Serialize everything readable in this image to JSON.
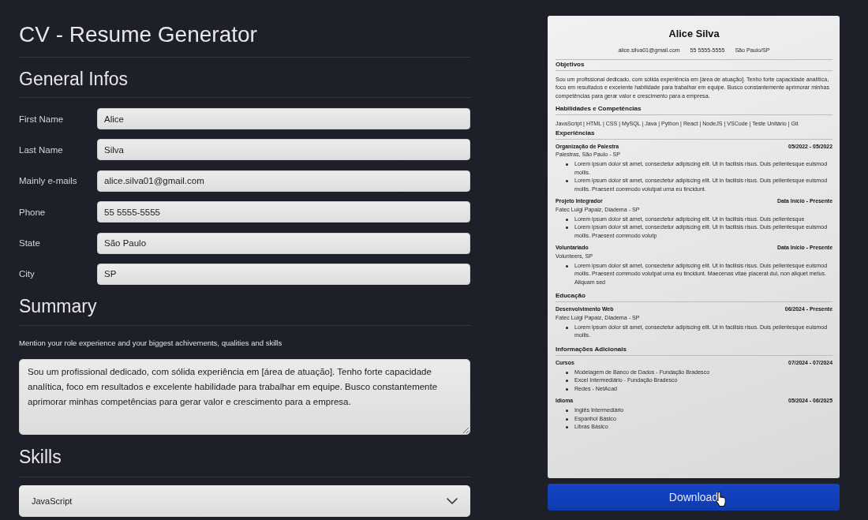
{
  "app": {
    "title": "CV - Resume Generator"
  },
  "general_infos": {
    "heading": "General Infos",
    "fields": [
      {
        "label": "First Name",
        "value": "Alice"
      },
      {
        "label": "Last Name",
        "value": "Silva"
      },
      {
        "label": "Mainly e-mails",
        "value": "alice.silva01@gmail.com"
      },
      {
        "label": "Phone",
        "value": "55 5555-5555"
      },
      {
        "label": "State",
        "value": "São Paulo"
      },
      {
        "label": "City",
        "value": "SP"
      }
    ]
  },
  "summary": {
    "heading": "Summary",
    "hint": "Mention your role experience and your biggest achivements, qualities and skills",
    "value": "Sou um profissional dedicado, com sólida experiência em [área de atuação]. Tenho forte capacidade analítica, foco em resultados e excelente habilidade para trabalhar em equipe. Busco constantemente aprimorar minhas competências para gerar valor e crescimento para a empresa."
  },
  "skills": {
    "heading": "Skills",
    "select": {
      "value": "JavaScript"
    }
  },
  "resume": {
    "name": "Alice Silva",
    "contacts": [
      "alice.silva01@gmail.com",
      "55 5555-5555",
      "São Paulo/SP"
    ],
    "sections": [
      {
        "kind": "paragraph",
        "heading": "Objetivos",
        "text": "Sou um profissional dedicado, com sólida experiência em [área de atuação]. Tenho forte capacidade analítica, foco em resultados e excelente habilidade para trabalhar em equipe. Busco constantemente aprimorar minhas competências para gerar valor e crescimento para a empresa."
      },
      {
        "kind": "line",
        "heading": "Habilidades e Competências",
        "text": "JavaScript | HTML | CSS | MySQL | Java | Python | React | NodeJS | VSCode | Teste Unitário | Git"
      },
      {
        "kind": "entries",
        "heading": "Experiências",
        "entries": [
          {
            "title": "Organização de Palestra",
            "dates": "05/2022 - 05/2022",
            "place": "Palestras, São Paulo - SP",
            "bullets": [
              "Lorem ipsum dolor sit amet, consectetur adipiscing elit. Ut in facilisis risus. Duis pellentesque euismod mollis.",
              "Lorem ipsum dolor sit amet, consectetur adipiscing elit. Ut in facilisis risus. Duis pellentesque euismod mollis. Praesent commodo volutpat urna eu tincidunt."
            ]
          },
          {
            "title": "Projeto Integrador",
            "dates": "Data Início - Presente",
            "place": "Fatec Luigi Papaiz, Diadema - SP",
            "bullets": [
              "Lorem ipsum dolor sit amet, consectetur adipiscing elit. Ut in facilisis risus. Duis pellentesque",
              "Lorem ipsum dolor sit amet, consectetur adipiscing elit. Ut in facilisis risus. Duis pellentesque euismod mollis. Praesent commodo volutp"
            ]
          },
          {
            "title": "Voluntariado",
            "dates": "Data Início - Presente",
            "place": "Volunteers, SP",
            "bullets": [
              "Lorem ipsum dolor sit amet, consectetur adipiscing elit. Ut in facilisis risus. Duis pellentesque euismod mollis. Praesent commodo volutpat urna eu tincidunt. Maecenas vitae placerat dui, non aliquet metus. Aliquam sed"
            ]
          }
        ]
      },
      {
        "kind": "entries",
        "heading": "Educação",
        "entries": [
          {
            "title": "Desenvolvimento Web",
            "dates": "06/2024 - Presente",
            "place": "Fatec Luigi Papaiz, Diadema - SP",
            "bullets": [
              "Lorem ipsum dolor sit amet, consectetur adipiscing elit. Ut in facilisis risus. Duis pellentesque euismod mollis."
            ]
          }
        ]
      },
      {
        "kind": "entries",
        "heading": "Informações Adicionais",
        "entries": [
          {
            "title": "Cursos",
            "dates": "07/2024 - 07/2024",
            "bullets": [
              "Modelagem de Banco de Dados - Fundação Bradesco",
              "Excel Intermediário - Fundação Bradesco",
              "Redes - NetAcad"
            ]
          },
          {
            "title": "Idioma",
            "dates": "05/2024 - 06/2025",
            "bullets": [
              "Inglês Intermediário",
              "Espanhol Básico",
              "Libras Básico"
            ]
          }
        ]
      }
    ]
  },
  "download_button": {
    "label": "Download"
  }
}
